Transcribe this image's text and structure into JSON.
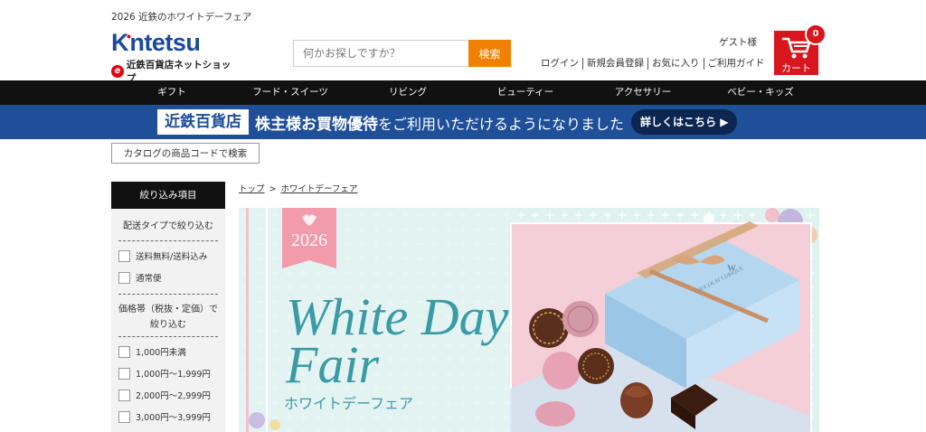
{
  "header": {
    "tagline": "2026 近鉄のホワイトデーフェア",
    "logo_main_1": "K",
    "logo_main_2": "ntetsu",
    "logo_sub": "近鉄百貨店ネットショップ",
    "logo_mark": "e",
    "search_placeholder": "何かお探しですか？",
    "search_button": "検索",
    "guest": "ゲスト様",
    "links": [
      "ログイン",
      "新規会員登録",
      "お気に入り",
      "ご利用ガイド"
    ],
    "cart_label": "カート",
    "cart_count": "0"
  },
  "nav": [
    "ギフト",
    "フード・スイーツ",
    "リビング",
    "ビューティー",
    "アクセサリー",
    "ベビー・キッズ"
  ],
  "banner": {
    "store": "近鉄百貨店",
    "bold_text": "株主様お買物優待",
    "rest_text": "をご利用いただけるようになりました",
    "cta": "詳しくはこちら"
  },
  "catalog_button": "カタログの商品コードで検索",
  "sidebar": {
    "title": "絞り込み項目",
    "delivery_heading": "配送タイプで絞り込む",
    "delivery_options": [
      "送料無料/送料込み",
      "通常便"
    ],
    "price_heading": "価格帯（税抜・定価）で絞り込む",
    "price_options": [
      "1,000円未満",
      "1,000円～1,999円",
      "2,000円～2,999円",
      "3,000円～3,999円"
    ]
  },
  "breadcrumb": [
    "トップ",
    "ホワイトデーフェア"
  ],
  "hero": {
    "year": "2026",
    "title_line1": "White Day",
    "title_line2": "Fair",
    "subtitle": "ホワイトデーフェア",
    "box_brand": "CHOCOLAT LURIQUE",
    "box_letter": "W"
  },
  "colors": {
    "brand_blue": "#1a4a9e",
    "search_orange": "#f08000",
    "cart_red": "#d7161d",
    "banner_blue": "#1e4f98",
    "nav_black": "#111111",
    "hero_teal": "#3a9aa6",
    "hero_pink": "#f19bab"
  }
}
